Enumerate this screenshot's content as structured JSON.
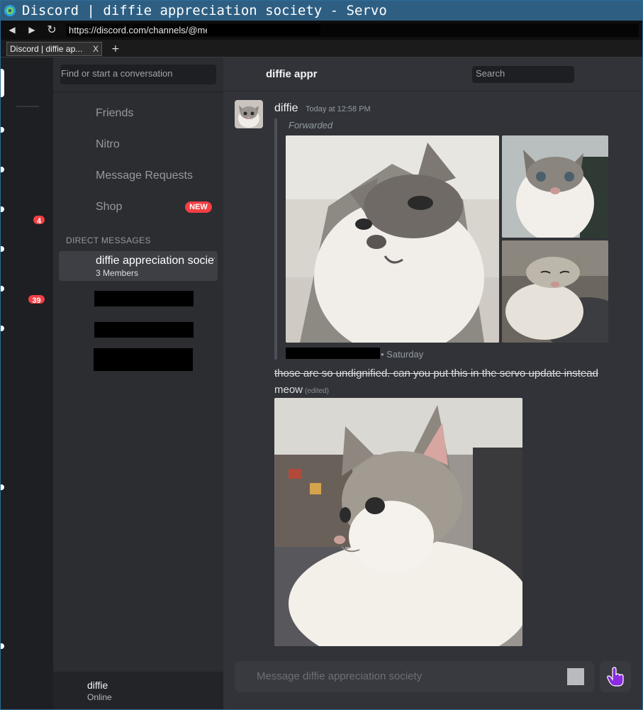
{
  "window": {
    "title": "Discord | diffie appreciation society - Servo"
  },
  "navbar": {
    "back_icon": "back-arrow-icon",
    "forward_icon": "forward-arrow-icon",
    "reload_icon": "reload-icon",
    "url": "https://discord.com/channels/@me/"
  },
  "tabs": {
    "items": [
      {
        "label": "Discord | diffie ap...",
        "close": "X"
      }
    ],
    "new_tab": "+"
  },
  "server_rail": {
    "badges": [
      "4",
      "39"
    ]
  },
  "dm_sidebar": {
    "search_placeholder": "Find or start a conversation",
    "nav": {
      "friends": "Friends",
      "nitro": "Nitro",
      "message_requests": "Message Requests",
      "shop": "Shop",
      "shop_badge": "NEW"
    },
    "section_header": "DIRECT MESSAGES",
    "active_dm": {
      "name": "diffie appreciation society",
      "subtitle": "3 Members"
    },
    "user": {
      "name": "diffie",
      "status": "Online"
    }
  },
  "chat": {
    "channel_name": "diffie appr",
    "search_placeholder": "Search",
    "message": {
      "author": "diffie",
      "timestamp": "Today at 12:58 PM",
      "forwarded_label": "Forwarded",
      "forwarded_meta": "• Saturday",
      "text_strikethrough": "those are so undignified. can you put this in the servo update instead",
      "text": "meow",
      "edited": "(edited)"
    },
    "composer_placeholder": "Message diffie appreciation society"
  },
  "colors": {
    "titlebar": "#2e5f83",
    "rail": "#1e1f22",
    "sidebar": "#2b2d31",
    "chat": "#313338",
    "badge_red": "#f23f43",
    "cursor_purple": "#8a2be2"
  }
}
